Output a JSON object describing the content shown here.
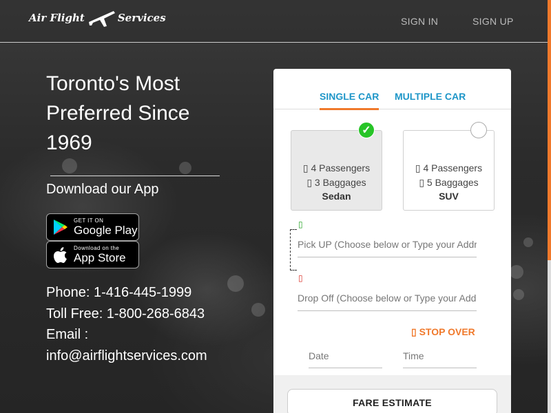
{
  "header": {
    "logo_left": "Air Flight",
    "logo_right": "Services",
    "nav": {
      "sign_in": "SIGN IN",
      "sign_up": "SIGN UP"
    }
  },
  "hero": {
    "headline_line1": "Toronto's Most",
    "headline_line2": "Preferred Since",
    "headline_line3": "1969",
    "download_title": "Download our App",
    "google_play": {
      "small": "GET IT ON",
      "big": "Google Play"
    },
    "app_store": {
      "small": "Download on the",
      "big": "App Store"
    },
    "contact": {
      "phone": "Phone: 1-416-445-1999",
      "toll_free": "Toll Free: 1-800-268-6843",
      "email_label": "Email :",
      "email": "info@airflightservices.com"
    }
  },
  "booking": {
    "tabs": [
      {
        "label": "SINGLE CAR",
        "active": true
      },
      {
        "label": "MULTIPLE CAR",
        "active": false
      }
    ],
    "vehicles": [
      {
        "passengers": "4 Passengers",
        "baggages": "3 Baggages",
        "name": "Sedan",
        "selected": true
      },
      {
        "passengers": "4 Passengers",
        "baggages": "5 Baggages",
        "name": "SUV",
        "selected": false
      }
    ],
    "pickup_placeholder": "Pick UP (Choose below or Type your Address)",
    "dropoff_placeholder": "Drop Off (Choose below or Type your Address)",
    "stop_over": "STOP OVER",
    "date_placeholder": "Date",
    "time_placeholder": "Time",
    "fare_estimate": "FARE ESTIMATE"
  },
  "colors": {
    "accent_orange": "#f0792b",
    "tab_blue": "#1e96c8",
    "check_green": "#27c427",
    "pickup_pin": "#27a327",
    "dropoff_pin": "#d9342b"
  },
  "icons": {
    "pickup": "map-marker-icon",
    "dropoff": "map-marker-icon",
    "passengers": "user-icon",
    "baggages": "suitcase-icon",
    "stop_over": "plus-icon"
  }
}
